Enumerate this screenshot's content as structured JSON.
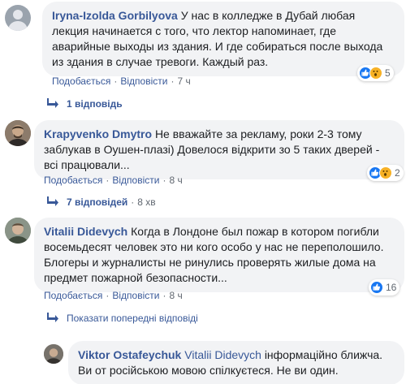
{
  "comments": [
    {
      "author": "Iryna-Izolda Gorbilyova",
      "text": "У нас в колледже в Дубай любая лекция начинается с того, что лектор напоминает, где аварийные выходы из здания. И где собираться после выхода из здания в случае тревоги. Каждый раз.",
      "like": "Подобається",
      "reply": "Відповісти",
      "time": "7 ч",
      "reaction_count": "5",
      "replies_label": "1 відповідь"
    },
    {
      "author": "Krapyvenko Dmytro",
      "text": "Не вважайте за рекламу, роки 2-3 тому заблукав в Оушен-плазі) Довелося відкрити зо 5 таких дверей - всі працювали...",
      "like": "Подобається",
      "reply": "Відповісти",
      "time": "8 ч",
      "reaction_count": "2",
      "replies_label": "7 відповідей",
      "replies_time": "8 хв"
    },
    {
      "author": "Vitalii Didevych",
      "text": "Когда в Лондоне был пожар в котором погибли восемьдесят человек это ни кого особо у нас не переполошило. Блогеры и журналисты не ринулись проверять жилые дома на предмет пожарной безопасности...",
      "like": "Подобається",
      "reply": "Відповісти",
      "time": "8 ч",
      "reaction_count": "16",
      "see_previous": "Показати попередні відповіді"
    }
  ],
  "reply": {
    "author": "Viktor Ostafeychuk",
    "mention": "Vitalii Didevych",
    "text": "інформаційно ближча. Ви от російською мовою спілкуєтеся. Не ви один."
  },
  "colors": {
    "link": "#385898",
    "bubble": "#f2f3f5",
    "like_blue": "#1877f2",
    "wow_yellow": "#f7b125"
  }
}
